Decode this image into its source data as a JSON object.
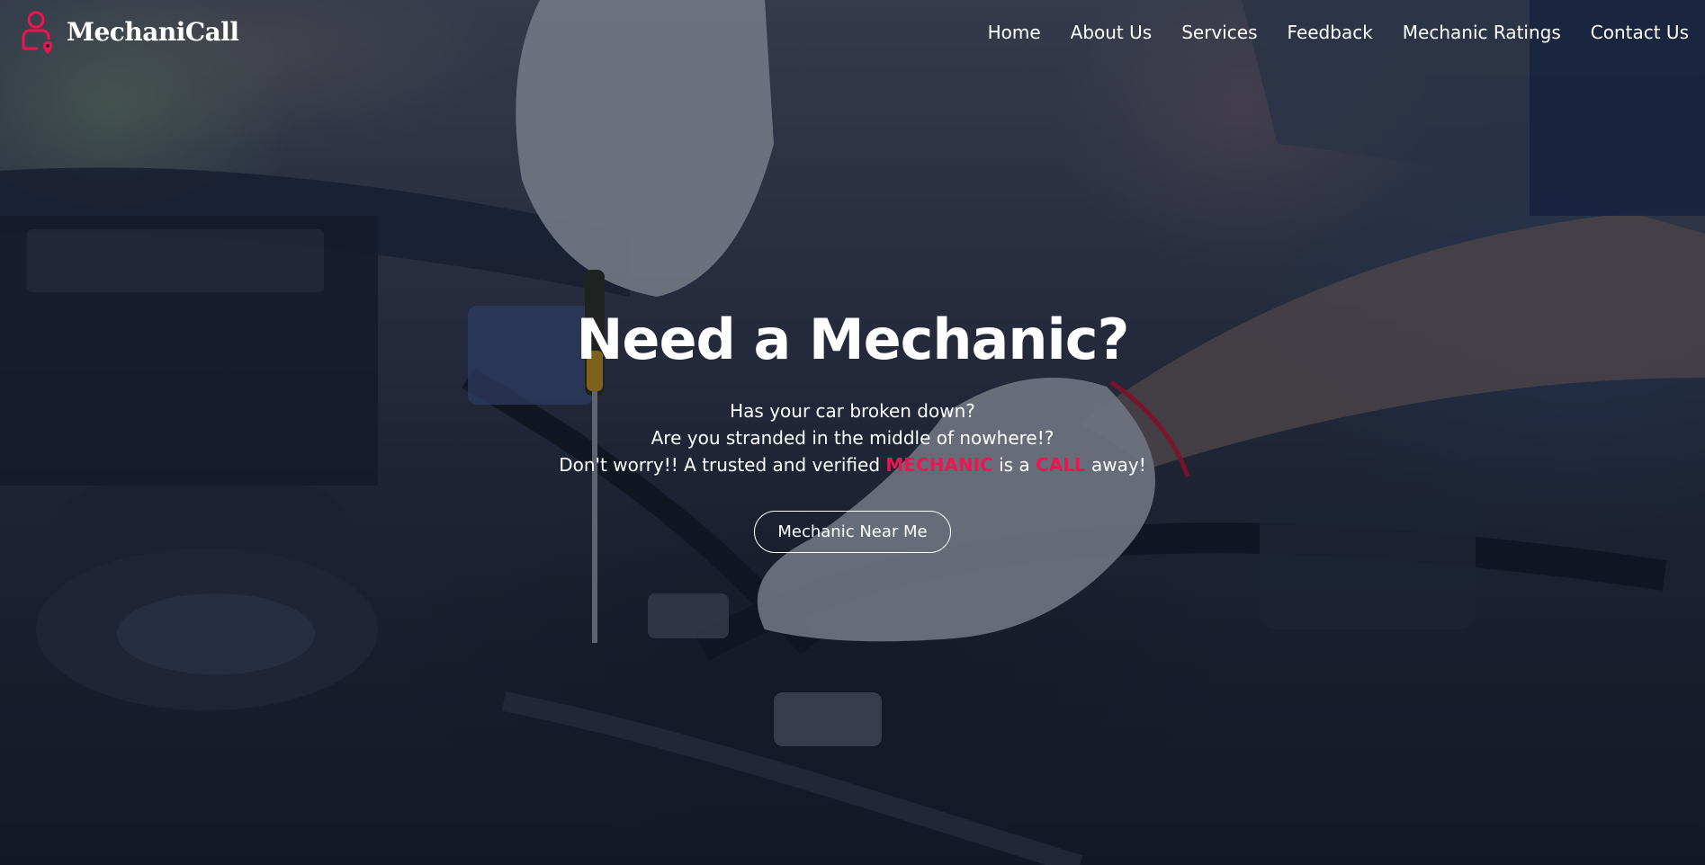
{
  "brand": {
    "name": "MechaniCall",
    "accent_color": "#f0144f",
    "icon": "person-location-pin-icon"
  },
  "nav": {
    "items": [
      {
        "label": "Home"
      },
      {
        "label": "About Us"
      },
      {
        "label": "Services"
      },
      {
        "label": "Feedback"
      },
      {
        "label": "Mechanic Ratings"
      },
      {
        "label": "Contact Us"
      }
    ]
  },
  "hero": {
    "title": "Need a Mechanic?",
    "line1": "Has your car broken down?",
    "line2": "Are you stranded in the middle of nowhere!?",
    "line3_part1": "Don't worry!! A trusted and verified ",
    "line3_highlight1": "MECHANIC",
    "line3_part2": " is a ",
    "line3_highlight2": "CALL",
    "line3_part3": " away!",
    "cta_label": "Mechanic Near Me",
    "background": "mechanic-working-on-engine-photo"
  }
}
